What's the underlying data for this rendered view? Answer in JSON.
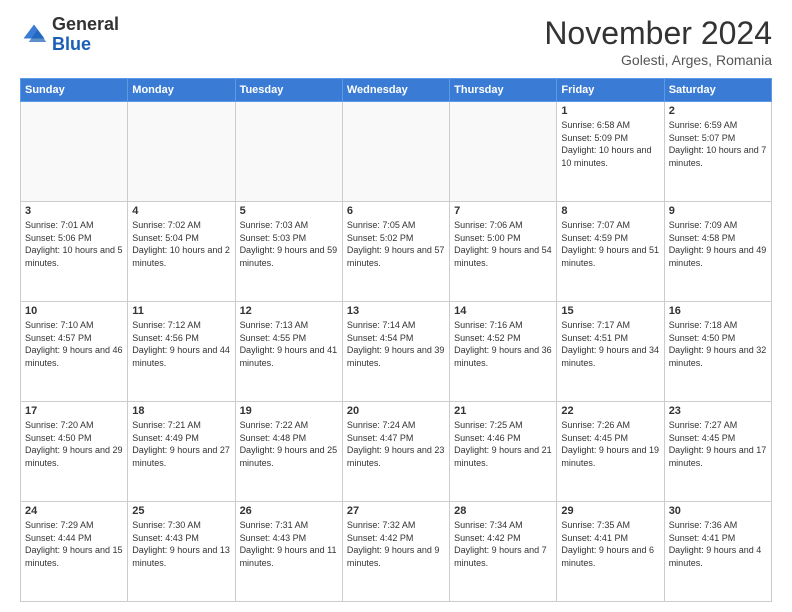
{
  "logo": {
    "general": "General",
    "blue": "Blue"
  },
  "title": "November 2024",
  "location": "Golesti, Arges, Romania",
  "weekdays": [
    "Sunday",
    "Monday",
    "Tuesday",
    "Wednesday",
    "Thursday",
    "Friday",
    "Saturday"
  ],
  "weeks": [
    [
      {
        "day": "",
        "info": ""
      },
      {
        "day": "",
        "info": ""
      },
      {
        "day": "",
        "info": ""
      },
      {
        "day": "",
        "info": ""
      },
      {
        "day": "",
        "info": ""
      },
      {
        "day": "1",
        "info": "Sunrise: 6:58 AM\nSunset: 5:09 PM\nDaylight: 10 hours and 10 minutes."
      },
      {
        "day": "2",
        "info": "Sunrise: 6:59 AM\nSunset: 5:07 PM\nDaylight: 10 hours and 7 minutes."
      }
    ],
    [
      {
        "day": "3",
        "info": "Sunrise: 7:01 AM\nSunset: 5:06 PM\nDaylight: 10 hours and 5 minutes."
      },
      {
        "day": "4",
        "info": "Sunrise: 7:02 AM\nSunset: 5:04 PM\nDaylight: 10 hours and 2 minutes."
      },
      {
        "day": "5",
        "info": "Sunrise: 7:03 AM\nSunset: 5:03 PM\nDaylight: 9 hours and 59 minutes."
      },
      {
        "day": "6",
        "info": "Sunrise: 7:05 AM\nSunset: 5:02 PM\nDaylight: 9 hours and 57 minutes."
      },
      {
        "day": "7",
        "info": "Sunrise: 7:06 AM\nSunset: 5:00 PM\nDaylight: 9 hours and 54 minutes."
      },
      {
        "day": "8",
        "info": "Sunrise: 7:07 AM\nSunset: 4:59 PM\nDaylight: 9 hours and 51 minutes."
      },
      {
        "day": "9",
        "info": "Sunrise: 7:09 AM\nSunset: 4:58 PM\nDaylight: 9 hours and 49 minutes."
      }
    ],
    [
      {
        "day": "10",
        "info": "Sunrise: 7:10 AM\nSunset: 4:57 PM\nDaylight: 9 hours and 46 minutes."
      },
      {
        "day": "11",
        "info": "Sunrise: 7:12 AM\nSunset: 4:56 PM\nDaylight: 9 hours and 44 minutes."
      },
      {
        "day": "12",
        "info": "Sunrise: 7:13 AM\nSunset: 4:55 PM\nDaylight: 9 hours and 41 minutes."
      },
      {
        "day": "13",
        "info": "Sunrise: 7:14 AM\nSunset: 4:54 PM\nDaylight: 9 hours and 39 minutes."
      },
      {
        "day": "14",
        "info": "Sunrise: 7:16 AM\nSunset: 4:52 PM\nDaylight: 9 hours and 36 minutes."
      },
      {
        "day": "15",
        "info": "Sunrise: 7:17 AM\nSunset: 4:51 PM\nDaylight: 9 hours and 34 minutes."
      },
      {
        "day": "16",
        "info": "Sunrise: 7:18 AM\nSunset: 4:50 PM\nDaylight: 9 hours and 32 minutes."
      }
    ],
    [
      {
        "day": "17",
        "info": "Sunrise: 7:20 AM\nSunset: 4:50 PM\nDaylight: 9 hours and 29 minutes."
      },
      {
        "day": "18",
        "info": "Sunrise: 7:21 AM\nSunset: 4:49 PM\nDaylight: 9 hours and 27 minutes."
      },
      {
        "day": "19",
        "info": "Sunrise: 7:22 AM\nSunset: 4:48 PM\nDaylight: 9 hours and 25 minutes."
      },
      {
        "day": "20",
        "info": "Sunrise: 7:24 AM\nSunset: 4:47 PM\nDaylight: 9 hours and 23 minutes."
      },
      {
        "day": "21",
        "info": "Sunrise: 7:25 AM\nSunset: 4:46 PM\nDaylight: 9 hours and 21 minutes."
      },
      {
        "day": "22",
        "info": "Sunrise: 7:26 AM\nSunset: 4:45 PM\nDaylight: 9 hours and 19 minutes."
      },
      {
        "day": "23",
        "info": "Sunrise: 7:27 AM\nSunset: 4:45 PM\nDaylight: 9 hours and 17 minutes."
      }
    ],
    [
      {
        "day": "24",
        "info": "Sunrise: 7:29 AM\nSunset: 4:44 PM\nDaylight: 9 hours and 15 minutes."
      },
      {
        "day": "25",
        "info": "Sunrise: 7:30 AM\nSunset: 4:43 PM\nDaylight: 9 hours and 13 minutes."
      },
      {
        "day": "26",
        "info": "Sunrise: 7:31 AM\nSunset: 4:43 PM\nDaylight: 9 hours and 11 minutes."
      },
      {
        "day": "27",
        "info": "Sunrise: 7:32 AM\nSunset: 4:42 PM\nDaylight: 9 hours and 9 minutes."
      },
      {
        "day": "28",
        "info": "Sunrise: 7:34 AM\nSunset: 4:42 PM\nDaylight: 9 hours and 7 minutes."
      },
      {
        "day": "29",
        "info": "Sunrise: 7:35 AM\nSunset: 4:41 PM\nDaylight: 9 hours and 6 minutes."
      },
      {
        "day": "30",
        "info": "Sunrise: 7:36 AM\nSunset: 4:41 PM\nDaylight: 9 hours and 4 minutes."
      }
    ]
  ]
}
